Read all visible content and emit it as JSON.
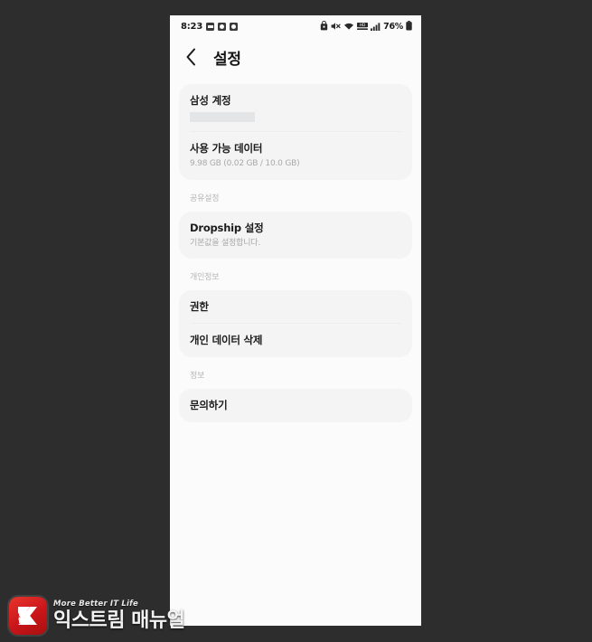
{
  "statusbar": {
    "time": "8:23",
    "notification_icons": [
      "sd-card-icon",
      "app-notification-icon",
      "app-notification-icon"
    ],
    "right_icons": [
      "vibrate-lock-icon",
      "mute-icon",
      "wifi-icon",
      "hd-icon",
      "signal-icon"
    ],
    "battery_percent": "76%",
    "battery_icon": "battery-icon"
  },
  "appbar": {
    "back_icon": "back-chevron-icon",
    "title": "설정"
  },
  "sections": [
    {
      "label": "",
      "rows": [
        {
          "title": "삼성 계정",
          "sub": "",
          "redacted": true
        },
        {
          "title": "사용 가능 데이터",
          "sub": "9.98 GB (0.02 GB / 10.0 GB)",
          "redacted": false
        }
      ]
    },
    {
      "label": "공유설정",
      "rows": [
        {
          "title": "Dropship 설정",
          "sub": "기본값을 설정합니다.",
          "redacted": false
        }
      ]
    },
    {
      "label": "개인정보",
      "rows": [
        {
          "title": "권한",
          "sub": "",
          "redacted": false
        },
        {
          "title": "개인 데이터 삭제",
          "sub": "",
          "redacted": false
        }
      ]
    },
    {
      "label": "정보",
      "rows": [
        {
          "title": "문의하기",
          "sub": "",
          "redacted": false
        }
      ]
    }
  ],
  "watermark": {
    "logo_icon": "extreme-manual-logo-icon",
    "tagline": "More Better IT Life",
    "brand": "익스트림 매뉴얼"
  },
  "colors": {
    "backdrop": "#2d2d2d",
    "screen": "#fbfbfb",
    "card": "#f4f4f4",
    "title_text": "#1c1c1c",
    "sub_text": "#a8a8a8",
    "section_label": "#b6b6b6",
    "logo_red": "#d4231d"
  }
}
